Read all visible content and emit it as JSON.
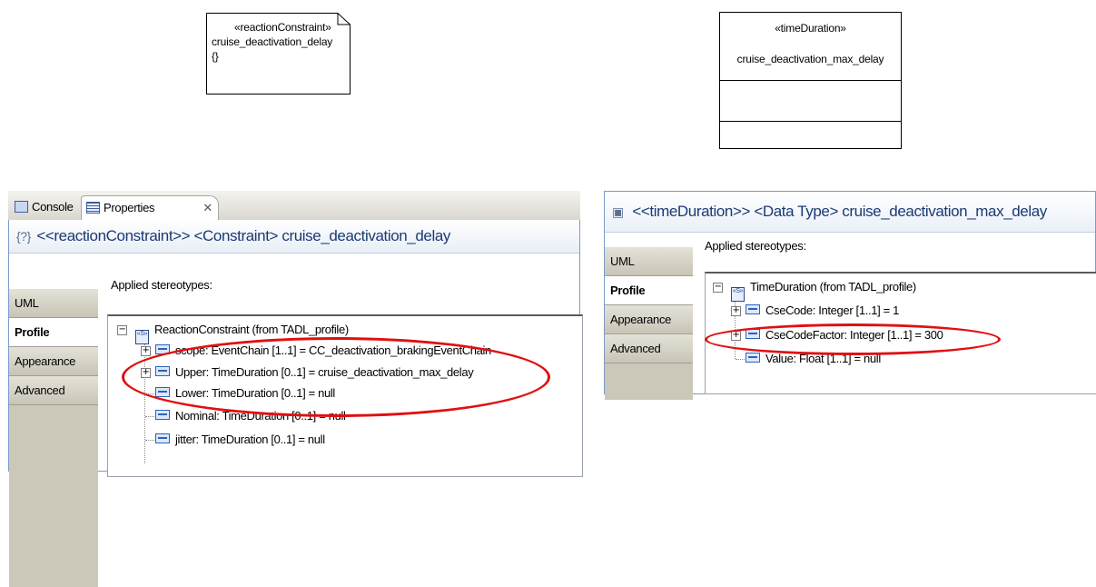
{
  "diagram": {
    "note": {
      "stereotype": "«reactionConstraint»",
      "name": "cruise_deactivation_delay",
      "body": "{}"
    },
    "class_box": {
      "stereotype": "«timeDuration»",
      "name": "cruise_deactivation_max_delay"
    }
  },
  "left_panel": {
    "tabs": {
      "console": "Console",
      "properties": "Properties",
      "close": "✕"
    },
    "title": "<<reactionConstraint>> <Constraint> cruise_deactivation_delay",
    "title_icon": "{?}",
    "side_tabs": [
      "UML",
      "Profile",
      "Appearance",
      "Advanced"
    ],
    "selected_tab": "Profile",
    "applied_label": "Applied stereotypes:",
    "tree": {
      "root": "ReactionConstraint   (from TADL_profile)",
      "items": [
        "scope: EventChain [1..1] = CC_deactivation_brakingEventChain",
        "Upper: TimeDuration [0..1] = cruise_deactivation_max_delay",
        "Lower: TimeDuration [0..1] = null",
        "Nominal: TimeDuration [0..1] = null",
        "jitter: TimeDuration [0..1] = null"
      ]
    }
  },
  "right_panel": {
    "title": "<<timeDuration>> <Data Type> cruise_deactivation_max_delay",
    "title_icon": "datatype-icon",
    "side_tabs": [
      "UML",
      "Profile",
      "Appearance",
      "Advanced"
    ],
    "selected_tab": "Profile",
    "applied_label": "Applied stereotypes:",
    "tree": {
      "root": "TimeDuration   (from TADL_profile)",
      "items": [
        "CseCode: Integer [1..1] = 1",
        "CseCodeFactor: Integer [1..1] = 300",
        "Value: Float [1..1] = null"
      ]
    }
  },
  "colors": {
    "highlight_ellipse": "#e01010",
    "title_text": "#1a3a73"
  }
}
